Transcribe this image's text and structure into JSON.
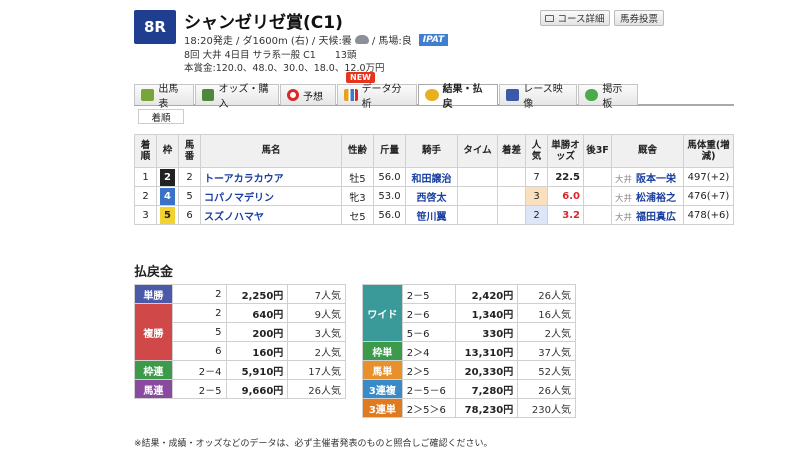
{
  "race": {
    "number": "8R",
    "title": "シャンゼリゼ賞(C1)",
    "info_text": "18:20発走 / ダ1600m (右) / 天候:曇",
    "track_text": "/ 馬場:良",
    "weather_icon": "cloud-icon",
    "ipat": "IPAT",
    "meta": "8回 大井 4日目 サラ系一般 C1　　13頭",
    "prize": "本賞金:120.0、48.0、30.0、18.0、12.0万円"
  },
  "buttons": {
    "course": "コース詳細",
    "vote": "馬券投票"
  },
  "tabs": [
    {
      "label": "出馬表",
      "icon": "table-icon"
    },
    {
      "label": "オッズ・購入",
      "icon": "odds-icon"
    },
    {
      "label": "予想",
      "icon": "target-icon"
    },
    {
      "label": "データ分析",
      "icon": "chart-icon"
    },
    {
      "label": "結果・払戻",
      "icon": "coins-icon"
    },
    {
      "label": "レース映像",
      "icon": "video-icon"
    },
    {
      "label": "掲示板",
      "icon": "chat-icon"
    }
  ],
  "new_badge": "NEW",
  "subtab": "着順",
  "results": {
    "headers": [
      "着順",
      "枠",
      "馬番",
      "馬名",
      "性齢",
      "斤量",
      "騎手",
      "タイム",
      "着差",
      "人気",
      "単勝オッズ",
      "後3F",
      "厩舎",
      "馬体重(増減)"
    ],
    "rows": [
      {
        "rank": "1",
        "waku": "2",
        "umaban": "2",
        "name": "トーアカラカウア",
        "sex_age": "牡5",
        "weight": "56.0",
        "jockey": "和田譲治",
        "time": "",
        "margin": "",
        "pop": "7",
        "odds": "22.5",
        "last3f": "",
        "aff": "大井",
        "trainer": "阪本一栄",
        "body": "497(+2)"
      },
      {
        "rank": "2",
        "waku": "4",
        "umaban": "5",
        "name": "コパノマデリン",
        "sex_age": "牝3",
        "weight": "53.0",
        "jockey": "西啓太",
        "time": "",
        "margin": "",
        "pop": "3",
        "odds": "6.0",
        "last3f": "",
        "aff": "大井",
        "trainer": "松浦裕之",
        "body": "476(+7)"
      },
      {
        "rank": "3",
        "waku": "5",
        "umaban": "6",
        "name": "スズノハマヤ",
        "sex_age": "セ5",
        "weight": "56.0",
        "jockey": "笹川翼",
        "time": "",
        "margin": "",
        "pop": "2",
        "odds": "3.2",
        "last3f": "",
        "aff": "大井",
        "trainer": "福田真広",
        "body": "478(+6)"
      }
    ]
  },
  "payout_title": "払戻金",
  "payout_left": [
    {
      "type": "単勝",
      "color": "#4a5aa8",
      "rows": [
        {
          "combo": "2",
          "amount": "2,250円",
          "pop": "7人気"
        }
      ]
    },
    {
      "type": "複勝",
      "color": "#d04848",
      "rows": [
        {
          "combo": "2",
          "amount": "640円",
          "pop": "9人気"
        },
        {
          "combo": "5",
          "amount": "200円",
          "pop": "3人気"
        },
        {
          "combo": "6",
          "amount": "160円",
          "pop": "2人気"
        }
      ]
    },
    {
      "type": "枠連",
      "color": "#3c9a4a",
      "rows": [
        {
          "combo": "2－4",
          "amount": "5,910円",
          "pop": "17人気"
        }
      ]
    },
    {
      "type": "馬連",
      "color": "#8a4aa0",
      "rows": [
        {
          "combo": "2－5",
          "amount": "9,660円",
          "pop": "26人気"
        }
      ]
    }
  ],
  "payout_right": [
    {
      "type": "ワイド",
      "color": "#3a9a9a",
      "rows": [
        {
          "combo": "2－5",
          "amount": "2,420円",
          "pop": "26人気"
        },
        {
          "combo": "2－6",
          "amount": "1,340円",
          "pop": "16人気"
        },
        {
          "combo": "5－6",
          "amount": "330円",
          "pop": "2人気"
        }
      ]
    },
    {
      "type": "枠単",
      "color": "#3c9a4a",
      "rows": [
        {
          "combo": "2＞4",
          "amount": "13,310円",
          "pop": "37人気"
        }
      ]
    },
    {
      "type": "馬単",
      "color": "#e8902c",
      "rows": [
        {
          "combo": "2＞5",
          "amount": "20,330円",
          "pop": "52人気"
        }
      ]
    },
    {
      "type": "3連複",
      "color": "#3a8ac8",
      "rows": [
        {
          "combo": "2－5－6",
          "amount": "7,280円",
          "pop": "26人気"
        }
      ]
    },
    {
      "type": "3連単",
      "color": "#e07a20",
      "rows": [
        {
          "combo": "2＞5＞6",
          "amount": "78,230円",
          "pop": "230人気"
        }
      ]
    }
  ],
  "footer": "※結果・成績・オッズなどのデータは、必ず主催者発表のものと照合しご確認ください。"
}
